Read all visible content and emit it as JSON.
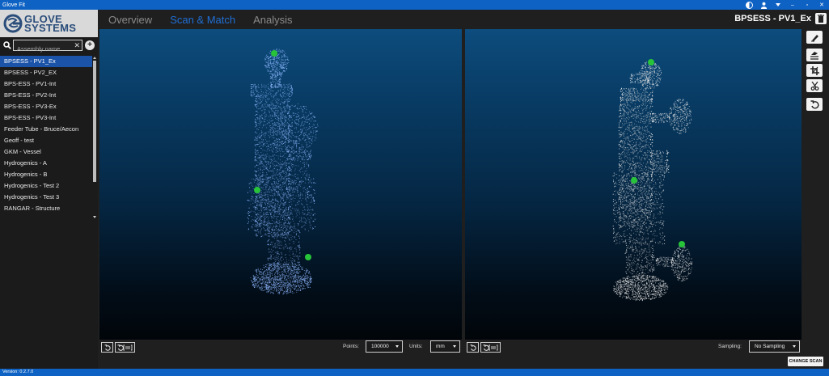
{
  "window": {
    "title": "Glove Fit",
    "controls": {
      "minimize": "–",
      "maximize": "▫",
      "close": "✕"
    },
    "icons": [
      "theme-toggle-icon",
      "user-icon",
      "user-menu-chevron-icon"
    ]
  },
  "brand": {
    "line1": "GLOVE",
    "line2": "SYSTEMS",
    "color": "#2a4d7a"
  },
  "search": {
    "placeholder": "Assembly name",
    "value": ""
  },
  "assemblies": [
    {
      "label": "BPSESS - PV1_Ex",
      "selected": true
    },
    {
      "label": "BPSESS - PV2_EX"
    },
    {
      "label": "BPS-ESS - PV1-Int"
    },
    {
      "label": "BPS-ESS - PV2-Int"
    },
    {
      "label": "BPS-ESS - PV3-Ex"
    },
    {
      "label": "BPS-ESS - PV3-Int"
    },
    {
      "label": "Feeder Tube - Bruce/Aecon"
    },
    {
      "label": "Geoff - test"
    },
    {
      "label": "GKM - Vessel"
    },
    {
      "label": "Hydrogenics - A"
    },
    {
      "label": "Hydrogenics - B"
    },
    {
      "label": "Hydrogenics - Test 2"
    },
    {
      "label": "Hydrogenics - Test 3"
    },
    {
      "label": "RANGAR - Structure"
    }
  ],
  "tabs": [
    {
      "label": "Overview",
      "active": false
    },
    {
      "label": "Scan & Match",
      "active": true
    },
    {
      "label": "Analysis",
      "active": false
    }
  ],
  "assembly_title": "BPSESS - PV1_Ex",
  "left_controls": {
    "points_label": "Points:",
    "points_value": "100000",
    "units_label": "Units:",
    "units_value": "mm"
  },
  "right_controls": {
    "sampling_label": "Sampling:",
    "sampling_value": "No Sampling"
  },
  "change_scan_label": "CHANGE SCAN",
  "toolbar_icons": [
    "eraser-icon",
    "align-icon",
    "crop-icon",
    "cut-icon",
    "reset-icon"
  ],
  "version": "Version: 0.2.7.0",
  "colors": {
    "accent": "#1f6fd6",
    "titlebar": "#0e62c4",
    "selection": "#1a53a8",
    "model_points": "#8fb8ff",
    "scan_points": "#e6e6e6",
    "marker": "#27c43a"
  }
}
